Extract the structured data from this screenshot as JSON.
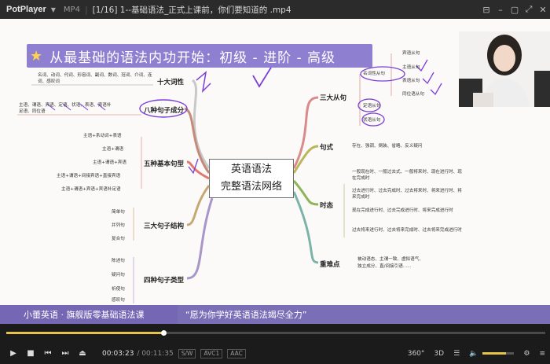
{
  "player": {
    "logo": "PotPlayer",
    "format": "MP4",
    "title": "[1/16] 1--基础语法_正式上课前，你们要知道的 .mp4"
  },
  "slide": {
    "banner": "从最基础的语法内功开始：初级 - 进阶 - 高级",
    "center_line1": "英语语法",
    "center_line2": "完整语法网络",
    "left_branches": [
      {
        "label": "十大词性",
        "detail": "名词、动词、代词、形容词、副词、数词、冠词、介词、连词、感叹词"
      },
      {
        "label": "八种句子成分",
        "detail1": "主语、谓语、宾语、定语、状语、表语、宾语补",
        "detail2": "足语、同位语"
      },
      {
        "label": "五种基本句型",
        "items": [
          "主语+系动词+表语",
          "主语+谓语",
          "主语+谓语+宾语",
          "主语+谓语+间接宾语+直接宾语",
          "主语+谓语+宾语+宾语补足语"
        ]
      },
      {
        "label": "三大句子结构",
        "items": [
          "简单句",
          "并列句",
          "复合句"
        ]
      },
      {
        "label": "四种句子类型",
        "items": [
          "陈述句",
          "疑问句",
          "祈使句",
          "感叹句"
        ]
      }
    ],
    "right_branches": {
      "clauses": {
        "label": "三大从句",
        "noun": "名词性从句",
        "noun_items": [
          "宾语从句",
          "主语从句",
          "表语从句",
          "同位语从句"
        ],
        "attr": "定语从句",
        "adv": "状语从句"
      },
      "pattern": {
        "label": "句式",
        "detail": "存在、强调、倒装、省略、反义疑问"
      },
      "tense": {
        "label": "时态",
        "items": [
          "一般现在时、一般过去式、一般将来时、现在进行时、现在完成时",
          "过去进行时、过去完成时、过去将来时、将来进行时、将来完成时",
          "现在完成进行时、过去完成进行时、将来完成进行时",
          "过去将来进行时、过去将来完成时、过去将来完成进行时"
        ]
      },
      "difficult": {
        "label": "重难点",
        "detail1": "被动语态、主谓一致、虚拟语气、",
        "detail2": "独立成分、直/间接引语......"
      }
    },
    "caption_left": "小蕾英语 · 旗舰版零基础语法课",
    "caption_right": "“愿为你学好英语语法竭尽全力”"
  },
  "controls": {
    "current_time": "00:03:23",
    "duration": "/ 00:11:35",
    "tags": [
      "S/W",
      "AVC1",
      "AAC"
    ],
    "right_labels": [
      "360°",
      "3D"
    ],
    "progress": 0.292,
    "volume": 0.75
  }
}
